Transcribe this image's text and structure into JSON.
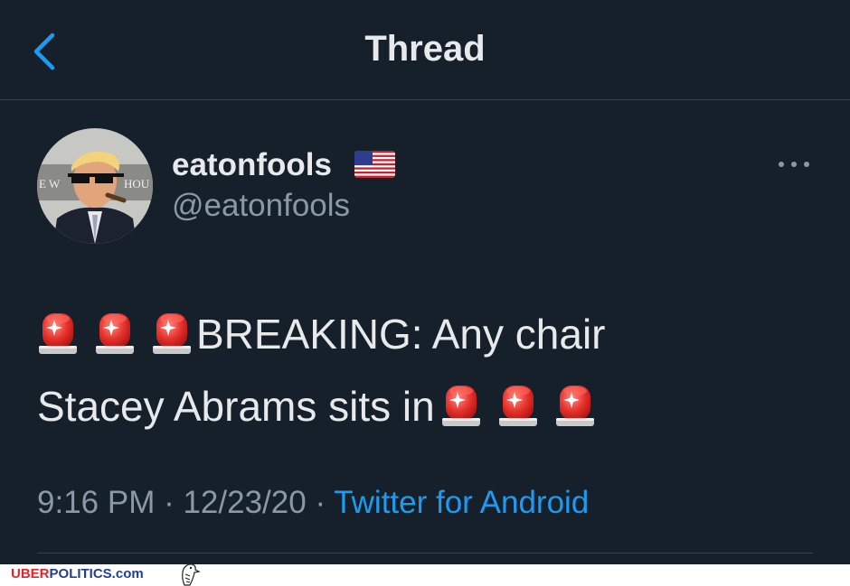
{
  "header": {
    "title": "Thread",
    "back_icon": "chevron-left-icon"
  },
  "author": {
    "display_name": "eatonfools",
    "flag_icon": "us-flag-icon",
    "handle": "@eatonfools",
    "avatar_sign_left": "E W",
    "avatar_sign_right": "HOU"
  },
  "more_icon": "more-horizontal-icon",
  "tweet": {
    "line1_text": "BREAKING: Any chair",
    "line2_text": "Stacey Abrams sits in",
    "emoji_icon": "police-siren-icon"
  },
  "meta": {
    "time": "9:16 PM",
    "separator": " · ",
    "date": "12/23/20",
    "source": "Twitter for Android"
  },
  "watermark": {
    "part1": "UBER",
    "part2": "POLITICS.com",
    "icon": "eagle-icon"
  },
  "colors": {
    "background": "#15202b",
    "text": "#e7e9ea",
    "muted": "#8b98a5",
    "link": "#1d9bf0",
    "divider": "#38444d"
  }
}
